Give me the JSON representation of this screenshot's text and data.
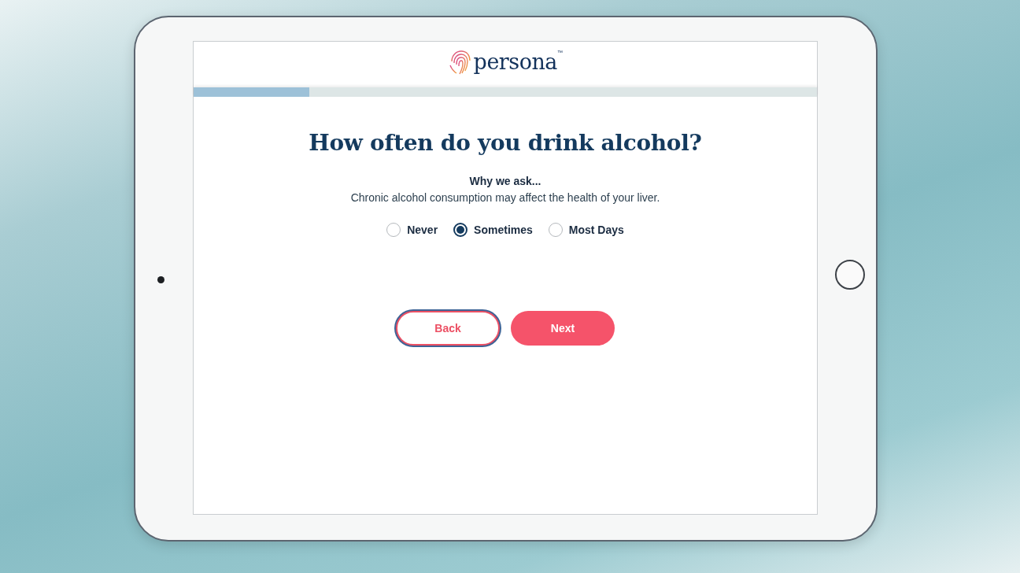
{
  "brand": {
    "name": "persona",
    "trademark": "™"
  },
  "progress": {
    "level": 0.185
  },
  "question": {
    "title": "How often do you drink alcohol?",
    "why_heading": "Why we ask...",
    "why_text": "Chronic alcohol consumption may affect the health of your liver."
  },
  "options": [
    {
      "label": "Never",
      "selected": false
    },
    {
      "label": "Sometimes",
      "selected": true
    },
    {
      "label": "Most Days",
      "selected": false
    }
  ],
  "buttons": [
    {
      "label": "Back",
      "kind": "outline",
      "focused": true
    },
    {
      "label": "Next",
      "kind": "primary",
      "focused": false
    }
  ]
}
